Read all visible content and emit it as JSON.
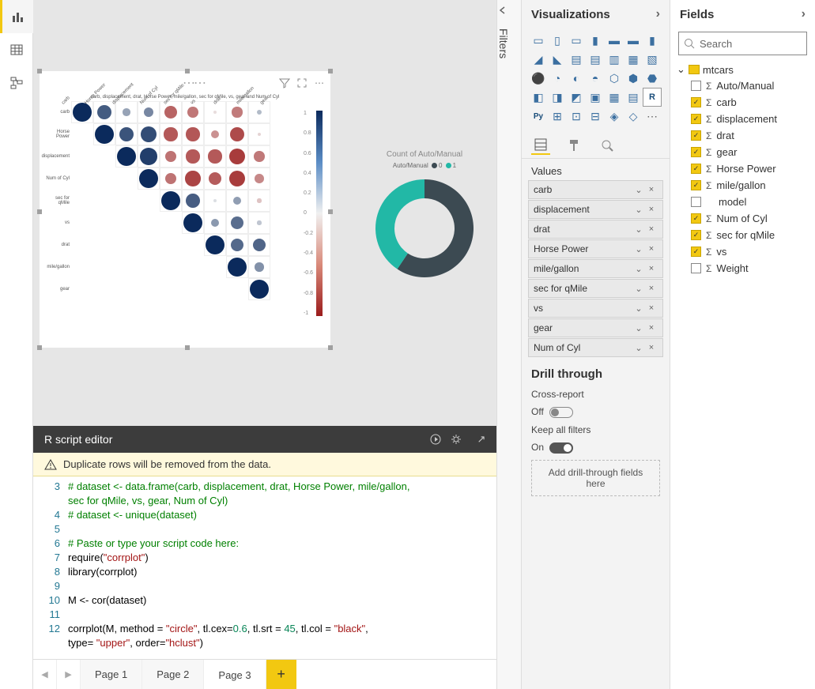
{
  "leftrail_active": 0,
  "panes": {
    "visualizations": "Visualizations",
    "fields": "Fields",
    "filters": "Filters"
  },
  "search": {
    "placeholder": "Search"
  },
  "table": {
    "name": "mtcars"
  },
  "fields": [
    {
      "name": "Auto/Manual",
      "checked": false,
      "sigma": true
    },
    {
      "name": "carb",
      "checked": true,
      "sigma": true
    },
    {
      "name": "displacement",
      "checked": true,
      "sigma": true
    },
    {
      "name": "drat",
      "checked": true,
      "sigma": true
    },
    {
      "name": "gear",
      "checked": true,
      "sigma": true
    },
    {
      "name": "Horse Power",
      "checked": true,
      "sigma": true
    },
    {
      "name": "mile/gallon",
      "checked": true,
      "sigma": true
    },
    {
      "name": "model",
      "checked": false,
      "sigma": false
    },
    {
      "name": "Num of Cyl",
      "checked": true,
      "sigma": true
    },
    {
      "name": "sec for qMile",
      "checked": true,
      "sigma": true
    },
    {
      "name": "vs",
      "checked": true,
      "sigma": true
    },
    {
      "name": "Weight",
      "checked": false,
      "sigma": true
    }
  ],
  "values_section": "Values",
  "values": [
    "carb",
    "displacement",
    "drat",
    "Horse Power",
    "mile/gallon",
    "sec for qMile",
    "vs",
    "gear",
    "Num of Cyl"
  ],
  "drill": {
    "title": "Drill through",
    "cross": "Cross-report",
    "cross_state": "Off",
    "keep": "Keep all filters",
    "keep_state": "On",
    "drop": "Add drill-through fields here"
  },
  "editor": {
    "title": "R script editor",
    "warning": "Duplicate rows will be removed from the data.",
    "lines": [
      {
        "n": 3,
        "seg": [
          {
            "t": "# dataset <- data.frame(carb, displacement, drat, Horse Power, mile/gallon, ",
            "c": "c-comment"
          }
        ]
      },
      {
        "n": "",
        "seg": [
          {
            "t": "sec for qMile, vs, gear, Num of Cyl)",
            "c": "c-comment"
          }
        ]
      },
      {
        "n": 4,
        "seg": [
          {
            "t": "# dataset <- unique(dataset)",
            "c": "c-comment"
          }
        ]
      },
      {
        "n": 5,
        "seg": []
      },
      {
        "n": 6,
        "seg": [
          {
            "t": "# Paste or type your script code here:",
            "c": "c-comment"
          }
        ]
      },
      {
        "n": 7,
        "seg": [
          {
            "t": "require(",
            "c": ""
          },
          {
            "t": "\"corrplot\"",
            "c": "c-str"
          },
          {
            "t": ")",
            "c": ""
          }
        ]
      },
      {
        "n": 8,
        "seg": [
          {
            "t": "library(corrplot)",
            "c": ""
          }
        ]
      },
      {
        "n": 9,
        "seg": []
      },
      {
        "n": 10,
        "seg": [
          {
            "t": "M <- cor(dataset)",
            "c": ""
          }
        ]
      },
      {
        "n": 11,
        "seg": []
      },
      {
        "n": 12,
        "seg": [
          {
            "t": "corrplot(M, method = ",
            "c": ""
          },
          {
            "t": "\"circle\"",
            "c": "c-str"
          },
          {
            "t": ", tl.cex=",
            "c": ""
          },
          {
            "t": "0.6",
            "c": "c-num"
          },
          {
            "t": ", tl.srt = ",
            "c": ""
          },
          {
            "t": "45",
            "c": "c-num"
          },
          {
            "t": ", tl.col = ",
            "c": ""
          },
          {
            "t": "\"black\"",
            "c": "c-str"
          },
          {
            "t": ", ",
            "c": ""
          }
        ]
      },
      {
        "n": "",
        "seg": [
          {
            "t": "type= ",
            "c": ""
          },
          {
            "t": "\"upper\"",
            "c": "c-str"
          },
          {
            "t": ", order=",
            "c": ""
          },
          {
            "t": "\"hclust\"",
            "c": "c-str"
          },
          {
            "t": ")",
            "c": ""
          }
        ]
      }
    ]
  },
  "pages": {
    "list": [
      "Page 1",
      "Page 2",
      "Page 3"
    ],
    "active": 2
  },
  "donut": {
    "title": "Count of Auto/Manual",
    "legend_prefix": "Auto/Manual",
    "legend": [
      {
        "label": "0",
        "color": "#3c4a52"
      },
      {
        "label": "1",
        "color": "#22b8a6"
      }
    ]
  },
  "chart_data": {
    "type": "heatmap",
    "title": "carb, displacement, drat, Horse Power, mile/gallon, sec for qMile, vs, gear and Num of Cyl",
    "variables": [
      "carb",
      "Horse Power",
      "displacement",
      "Num of Cyl",
      "sec for qMile",
      "vs",
      "drat",
      "mile/gallon",
      "gear"
    ],
    "layout": "upper",
    "method": "circle",
    "order": "hclust",
    "colorbar": {
      "min": -1,
      "max": 1,
      "ticks": [
        -1,
        -0.8,
        -0.6,
        -0.4,
        -0.2,
        0,
        0.2,
        0.4,
        0.6,
        0.8,
        1
      ]
    },
    "matrix": [
      [
        1,
        0.75,
        0.39,
        0.53,
        -0.66,
        -0.57,
        -0.09,
        -0.55,
        0.27
      ],
      [
        0.75,
        1,
        0.79,
        0.83,
        -0.71,
        -0.72,
        -0.45,
        -0.78,
        -0.13
      ],
      [
        0.39,
        0.79,
        1,
        0.9,
        -0.59,
        -0.71,
        -0.71,
        -0.85,
        -0.56
      ],
      [
        0.53,
        0.83,
        0.9,
        1,
        -0.59,
        -0.81,
        -0.7,
        -0.85,
        -0.49
      ],
      [
        -0.66,
        -0.71,
        -0.59,
        -0.59,
        1,
        0.74,
        0.09,
        0.42,
        -0.21
      ],
      [
        -0.57,
        -0.72,
        -0.71,
        -0.81,
        0.74,
        1,
        0.44,
        0.66,
        0.21
      ],
      [
        -0.09,
        -0.45,
        -0.71,
        -0.7,
        0.09,
        0.44,
        1,
        0.68,
        0.7
      ],
      [
        -0.55,
        -0.78,
        -0.85,
        -0.85,
        0.42,
        0.66,
        0.68,
        1,
        0.48
      ],
      [
        0.27,
        -0.13,
        -0.56,
        -0.49,
        -0.21,
        0.21,
        0.7,
        0.48,
        1
      ]
    ],
    "donut": {
      "type": "pie",
      "title": "Count of Auto/Manual",
      "categories": [
        "0",
        "1"
      ],
      "values": [
        19,
        13
      ]
    }
  }
}
